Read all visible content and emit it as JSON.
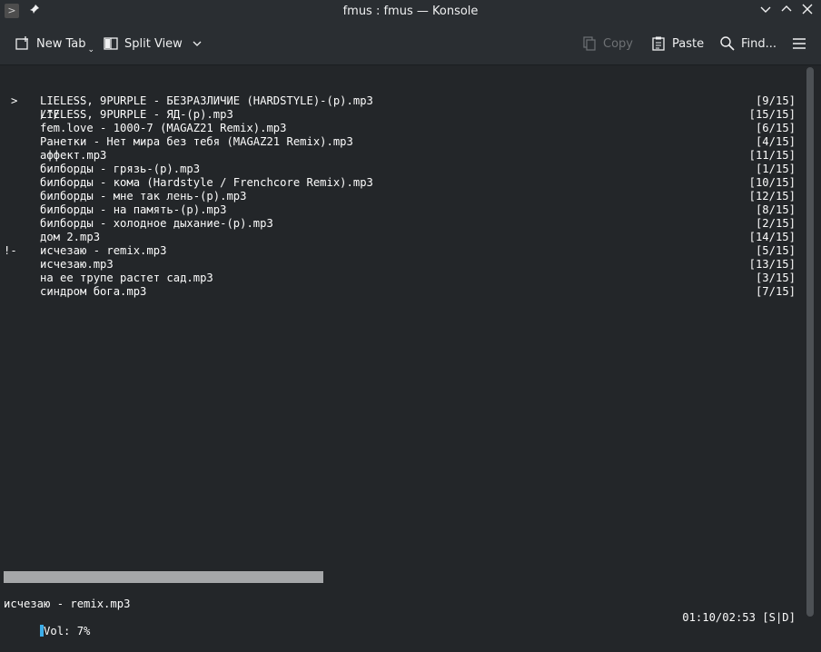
{
  "window": {
    "title": "fmus : fmus — Konsole"
  },
  "toolbar": {
    "new_tab": "New Tab",
    "split_view": "Split View",
    "copy": "Copy",
    "paste": "Paste",
    "find": "Find..."
  },
  "terminal": {
    "prompt": {
      "mark": ">",
      "text": "/^/"
    },
    "tracks": [
      {
        "mark": "",
        "name": "LIELESS, 9PURPLE - БЕЗРАЗЛИЧИЕ (HARDSTYLE)-(p).mp3",
        "index": "[9/15]"
      },
      {
        "mark": "",
        "name": "LIELESS, 9PURPLE - ЯД-(p).mp3",
        "index": "[15/15]"
      },
      {
        "mark": "",
        "name": "fem.love - 1000-7 (MAGAZ21 Remix).mp3",
        "index": "[6/15]"
      },
      {
        "mark": "",
        "name": "Ранетки - Нет мира без тебя (MAGAZ21 Remix).mp3",
        "index": "[4/15]"
      },
      {
        "mark": "",
        "name": "аффект.mp3",
        "index": "[11/15]"
      },
      {
        "mark": "",
        "name": "билборды - грязь-(p).mp3",
        "index": "[1/15]"
      },
      {
        "mark": "",
        "name": "билборды - кома (Hardstyle / Frenchcore Remix).mp3",
        "index": "[10/15]"
      },
      {
        "mark": "",
        "name": "билборды - мне так лень-(p).mp3",
        "index": "[12/15]"
      },
      {
        "mark": "",
        "name": "билборды - на память-(p).mp3",
        "index": "[8/15]"
      },
      {
        "mark": "",
        "name": "билборды - холодное дыхание-(p).mp3",
        "index": "[2/15]"
      },
      {
        "mark": "",
        "name": "дом 2.mp3",
        "index": "[14/15]"
      },
      {
        "mark": "!-",
        "name": "исчезаю - remix.mp3",
        "index": "[5/15]"
      },
      {
        "mark": "",
        "name": "исчезаю.mp3",
        "index": "[13/15]"
      },
      {
        "mark": "",
        "name": "на ее трупе растет сад.mp3",
        "index": "[3/15]"
      },
      {
        "mark": "",
        "name": "синдром бога.mp3",
        "index": "[7/15]"
      }
    ],
    "now_playing": "исчезаю - remix.mp3",
    "time": "01:10/02:53 [S|D]",
    "volume": "Vol: 7%",
    "progress_fraction": 0.405
  },
  "colors": {
    "background": "#232629",
    "text": "#fcfcfc",
    "progress": "#a5a7a9",
    "accent": "#3daee9"
  }
}
